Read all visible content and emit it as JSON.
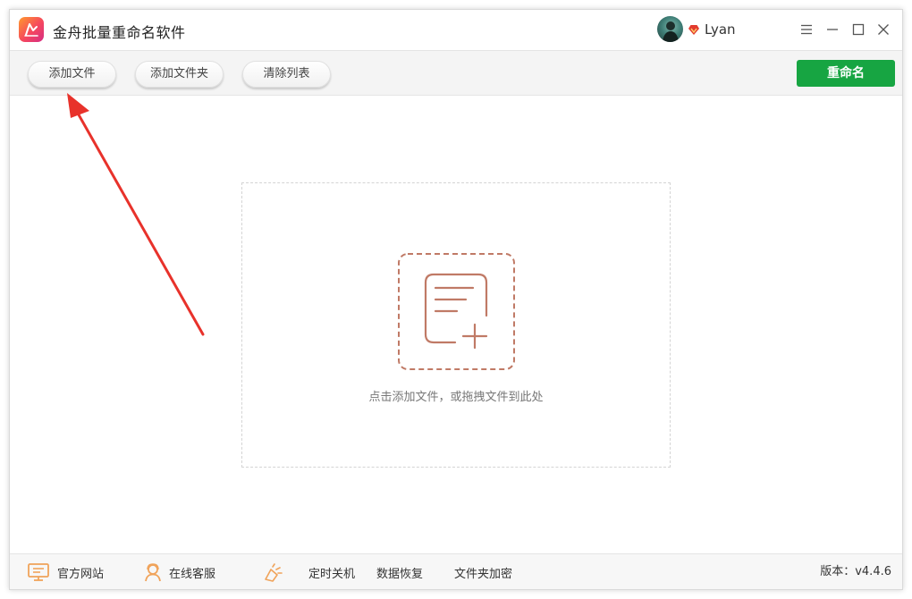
{
  "window": {
    "title": "金舟批量重命名软件",
    "user": {
      "name": "Lyan"
    }
  },
  "toolbar": {
    "add_file_label": "添加文件",
    "add_folder_label": "添加文件夹",
    "clear_list_label": "清除列表",
    "rename_label": "重命名"
  },
  "main": {
    "dropzone_hint": "点击添加文件，或拖拽文件到此处"
  },
  "footer": {
    "items": [
      {
        "label": "官方网站",
        "icon": "monitor-icon"
      },
      {
        "label": "在线客服",
        "icon": "customer-service-icon"
      },
      {
        "label": "定时关机",
        "icon": "power-timer-icon"
      },
      {
        "label": "数据恢复"
      },
      {
        "label": "文件夹加密"
      }
    ],
    "version": "版本：v4.4.6"
  },
  "colors": {
    "accent_green": "#17a542",
    "icon_brown": "#c07a66",
    "footer_icon_orange": "#f0a35a",
    "arrow_red": "#e8322b"
  }
}
